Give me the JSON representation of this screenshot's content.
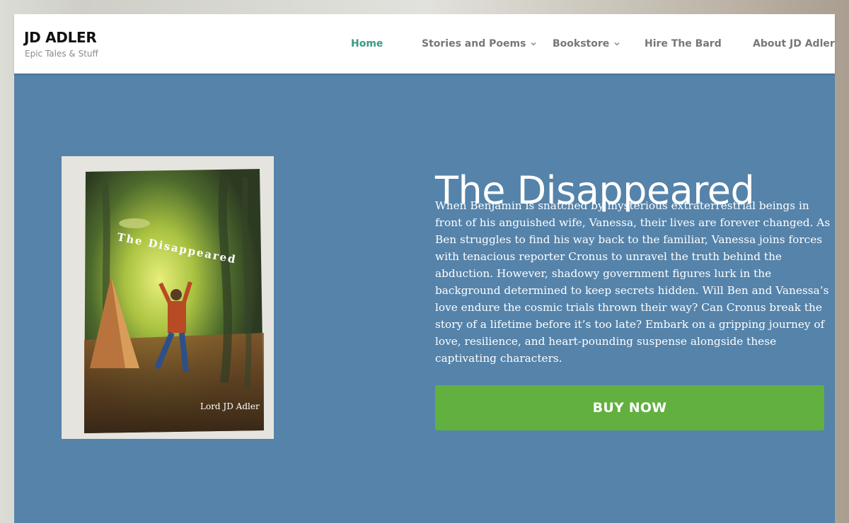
{
  "site": {
    "title": "JD ADLER",
    "tagline": "Epic Tales & Stuff"
  },
  "nav": {
    "items": [
      {
        "label": "Home",
        "active": true,
        "has_dropdown": false
      },
      {
        "label": "Stories and Poems",
        "active": false,
        "has_dropdown": true
      },
      {
        "label": "Bookstore",
        "active": false,
        "has_dropdown": true
      },
      {
        "label": "Hire The Bard",
        "active": false,
        "has_dropdown": false
      },
      {
        "label": "About JD Adler",
        "active": false,
        "has_dropdown": false
      }
    ]
  },
  "book": {
    "title": "The Disappeared",
    "cover_title": "The Disappeared",
    "cover_author": "Lord JD Adler",
    "description_lines": [
      "When Benjamin is snatched by mysterious extraterrestrial beings in",
      "front of his anguished wife, Vanessa, their lives are forever changed. As",
      "Ben struggles to find his way back to the familiar, Vanessa joins forces",
      "with tenacious reporter Cronus to unravel the truth behind the",
      "abduction. However, shadowy government figures lurk in the",
      "background determined to keep secrets hidden. Will Ben and Vanessa’s",
      "love endure the cosmic trials thrown their way? Can Cronus break the",
      "story of a lifetime before it’s too late? Embark on a gripping journey of",
      "love, resilience, and heart-pounding suspense alongside these",
      "captivating characters."
    ],
    "buy_label": "BUY NOW"
  },
  "colors": {
    "hero_background": "#5583aa",
    "nav_active": "#3a9a83",
    "buy_button": "#62b03f"
  }
}
